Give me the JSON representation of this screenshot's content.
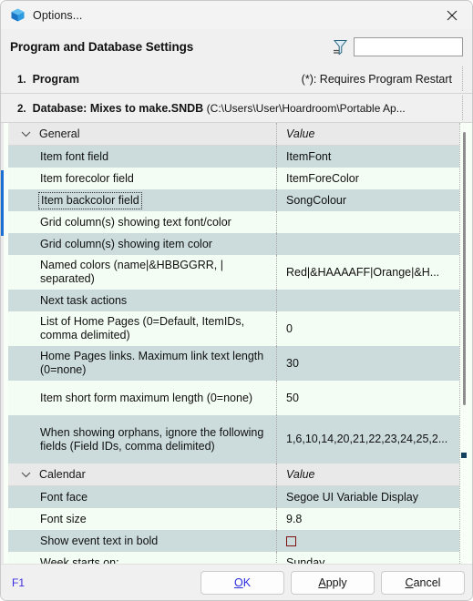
{
  "window": {
    "title": "Options...",
    "icon": "cube-icon",
    "close_label": "✕"
  },
  "header": {
    "title": "Program and Database Settings",
    "filter_icon": "filter-icon",
    "filter_value": "",
    "filter_placeholder": ""
  },
  "sections": [
    {
      "number": "1.",
      "label": "Program",
      "sub": "",
      "right": "(*): Requires Program Restart"
    },
    {
      "number": "2.",
      "label": "Database: Mixes to make.SNDB",
      "sub": "(C:\\Users\\User\\Hoardroom\\Portable Ap...",
      "right": ""
    }
  ],
  "grid": {
    "value_header": "Value",
    "groups": [
      {
        "name": "General",
        "expanded": true,
        "rows": [
          {
            "name": "Item font field",
            "value": "ItemFont",
            "selected": false,
            "type": "text"
          },
          {
            "name": "Item forecolor field",
            "value": "ItemForeColor",
            "selected": false,
            "type": "text"
          },
          {
            "name": "Item backcolor field",
            "value": "SongColour",
            "selected": true,
            "type": "text"
          },
          {
            "name": "Grid column(s) showing text font/color",
            "value": "",
            "selected": false,
            "type": "text"
          },
          {
            "name": "Grid column(s) showing item color",
            "value": "",
            "selected": false,
            "type": "text"
          },
          {
            "name": "Named colors (name|&HBBGGRR, | separated)",
            "value": "Red|&HAAAAFF|Orange|&H...",
            "selected": false,
            "type": "text"
          },
          {
            "name": "Next task actions",
            "value": "",
            "selected": false,
            "type": "text"
          },
          {
            "name": "List of Home Pages (0=Default, ItemIDs, comma delimited)",
            "value": "0",
            "selected": false,
            "type": "text"
          },
          {
            "name": "Home Pages links. Maximum link text length (0=none)",
            "value": "30",
            "selected": false,
            "type": "text"
          },
          {
            "name": "Item short form maximum length (0=none)",
            "value": "50",
            "selected": false,
            "type": "text"
          },
          {
            "name": "When showing orphans, ignore the following fields (Field IDs, comma delimited)",
            "value": "1,6,10,14,20,21,22,23,24,25,2...",
            "selected": false,
            "type": "text"
          }
        ]
      },
      {
        "name": "Calendar",
        "expanded": true,
        "rows": [
          {
            "name": "Font face",
            "value": "Segoe UI Variable Display",
            "selected": false,
            "type": "text"
          },
          {
            "name": "Font size",
            "value": "9.8",
            "selected": false,
            "type": "text"
          },
          {
            "name": "Show event text in bold",
            "value": "",
            "selected": false,
            "type": "checkbox",
            "checked": false
          },
          {
            "name": "Week starts on:",
            "value": "Sunday",
            "selected": false,
            "type": "text"
          }
        ]
      }
    ]
  },
  "footer": {
    "help_label": "F1",
    "buttons": [
      {
        "name": "ok",
        "pre": "",
        "accel": "O",
        "post": "K",
        "primary": true
      },
      {
        "name": "apply",
        "pre": "",
        "accel": "A",
        "post": "pply",
        "primary": false
      },
      {
        "name": "cancel",
        "pre": "",
        "accel": "C",
        "post": "ancel",
        "primary": false
      }
    ]
  },
  "colors": {
    "row_shade": "#ccdcdc",
    "row_light": "#f4fdf4",
    "group_header": "#e9e9e9",
    "accent_link": "#3b2ae0",
    "checkbox_border": "#7d1111"
  }
}
